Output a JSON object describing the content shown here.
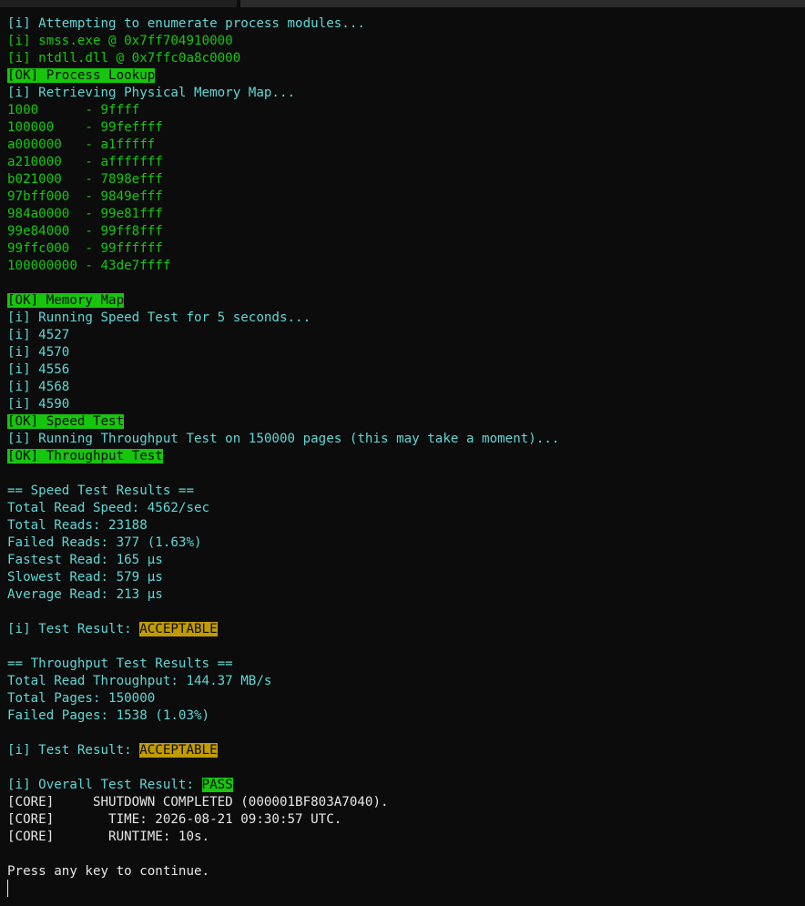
{
  "terminal": {
    "lines": [
      {
        "segments": [
          {
            "text": "[i] Attempting to enumerate process modules...",
            "style": "cyan"
          }
        ]
      },
      {
        "segments": [
          {
            "text": "[i] smss.exe @ 0x7ff704910000",
            "style": "green"
          }
        ]
      },
      {
        "segments": [
          {
            "text": "[i] ntdll.dll @ 0x7ffc0a8c0000",
            "style": "green"
          }
        ]
      },
      {
        "segments": [
          {
            "text": "[OK] Process Lookup",
            "style": "ok"
          }
        ]
      },
      {
        "segments": [
          {
            "text": "[i] Retrieving Physical Memory Map...",
            "style": "cyan"
          }
        ]
      },
      {
        "segments": [
          {
            "text": "1000      - 9ffff",
            "style": "green"
          }
        ]
      },
      {
        "segments": [
          {
            "text": "100000    - 99feffff",
            "style": "green"
          }
        ]
      },
      {
        "segments": [
          {
            "text": "a000000   - a1fffff",
            "style": "green"
          }
        ]
      },
      {
        "segments": [
          {
            "text": "a210000   - afffffff",
            "style": "green"
          }
        ]
      },
      {
        "segments": [
          {
            "text": "b021000   - 7898efff",
            "style": "green"
          }
        ]
      },
      {
        "segments": [
          {
            "text": "97bff000  - 9849efff",
            "style": "green"
          }
        ]
      },
      {
        "segments": [
          {
            "text": "984a0000  - 99e81fff",
            "style": "green"
          }
        ]
      },
      {
        "segments": [
          {
            "text": "99e84000  - 99ff8fff",
            "style": "green"
          }
        ]
      },
      {
        "segments": [
          {
            "text": "99ffc000  - 99ffffff",
            "style": "green"
          }
        ]
      },
      {
        "segments": [
          {
            "text": "100000000 - 43de7ffff",
            "style": "green"
          }
        ]
      },
      {
        "segments": [
          {
            "text": "",
            "style": "white"
          }
        ]
      },
      {
        "segments": [
          {
            "text": "[OK] Memory Map",
            "style": "ok"
          }
        ]
      },
      {
        "segments": [
          {
            "text": "[i] Running Speed Test for 5 seconds...",
            "style": "cyan"
          }
        ]
      },
      {
        "segments": [
          {
            "text": "[i] 4527",
            "style": "cyan"
          }
        ]
      },
      {
        "segments": [
          {
            "text": "[i] 4570",
            "style": "cyan"
          }
        ]
      },
      {
        "segments": [
          {
            "text": "[i] 4556",
            "style": "cyan"
          }
        ]
      },
      {
        "segments": [
          {
            "text": "[i] 4568",
            "style": "cyan"
          }
        ]
      },
      {
        "segments": [
          {
            "text": "[i] 4590",
            "style": "cyan"
          }
        ]
      },
      {
        "segments": [
          {
            "text": "[OK] Speed Test",
            "style": "ok"
          }
        ]
      },
      {
        "segments": [
          {
            "text": "[i] Running Throughput Test on 150000 pages (this may take a moment)...",
            "style": "cyan"
          }
        ]
      },
      {
        "segments": [
          {
            "text": "[OK] Throughput Test",
            "style": "ok"
          }
        ]
      },
      {
        "segments": [
          {
            "text": "",
            "style": "white"
          }
        ]
      },
      {
        "segments": [
          {
            "text": "== Speed Test Results ==",
            "style": "cyan"
          }
        ]
      },
      {
        "segments": [
          {
            "text": "Total Read Speed: 4562/sec",
            "style": "cyan"
          }
        ]
      },
      {
        "segments": [
          {
            "text": "Total Reads: 23188",
            "style": "cyan"
          }
        ]
      },
      {
        "segments": [
          {
            "text": "Failed Reads: 377 (1.63%)",
            "style": "cyan"
          }
        ]
      },
      {
        "segments": [
          {
            "text": "Fastest Read: 165 µs",
            "style": "cyan"
          }
        ]
      },
      {
        "segments": [
          {
            "text": "Slowest Read: 579 µs",
            "style": "cyan"
          }
        ]
      },
      {
        "segments": [
          {
            "text": "Average Read: 213 µs",
            "style": "cyan"
          }
        ]
      },
      {
        "segments": [
          {
            "text": "",
            "style": "white"
          }
        ]
      },
      {
        "segments": [
          {
            "text": "[i] Test Result: ",
            "style": "cyan"
          },
          {
            "text": "ACCEPTABLE",
            "style": "warn"
          }
        ]
      },
      {
        "segments": [
          {
            "text": "",
            "style": "white"
          }
        ]
      },
      {
        "segments": [
          {
            "text": "== Throughput Test Results ==",
            "style": "cyan"
          }
        ]
      },
      {
        "segments": [
          {
            "text": "Total Read Throughput: 144.37 MB/s",
            "style": "cyan"
          }
        ]
      },
      {
        "segments": [
          {
            "text": "Total Pages: 150000",
            "style": "cyan"
          }
        ]
      },
      {
        "segments": [
          {
            "text": "Failed Pages: 1538 (1.03%)",
            "style": "cyan"
          }
        ]
      },
      {
        "segments": [
          {
            "text": "",
            "style": "white"
          }
        ]
      },
      {
        "segments": [
          {
            "text": "[i] Test Result: ",
            "style": "cyan"
          },
          {
            "text": "ACCEPTABLE",
            "style": "warn"
          }
        ]
      },
      {
        "segments": [
          {
            "text": "",
            "style": "white"
          }
        ]
      },
      {
        "segments": [
          {
            "text": "[i] Overall Test Result: ",
            "style": "cyan"
          },
          {
            "text": "PASS",
            "style": "pass"
          }
        ]
      },
      {
        "segments": [
          {
            "text": "[CORE]     SHUTDOWN COMPLETED (000001BF803A7040).",
            "style": "white"
          }
        ]
      },
      {
        "segments": [
          {
            "text": "[CORE]       TIME: 2026-08-21 09:30:57 UTC.",
            "style": "white"
          }
        ]
      },
      {
        "segments": [
          {
            "text": "[CORE]       RUNTIME: 10s.",
            "style": "white"
          }
        ]
      },
      {
        "segments": [
          {
            "text": "",
            "style": "white"
          }
        ]
      },
      {
        "segments": [
          {
            "text": "Press any key to continue.",
            "style": "white"
          }
        ]
      }
    ]
  },
  "colors": {
    "background": "#0c0c0c",
    "cyan": "#61d6d6",
    "green": "#13c90f",
    "white": "#e6e6e6",
    "ok_highlight": "#16c60c",
    "warn_highlight": "#c19c00"
  }
}
